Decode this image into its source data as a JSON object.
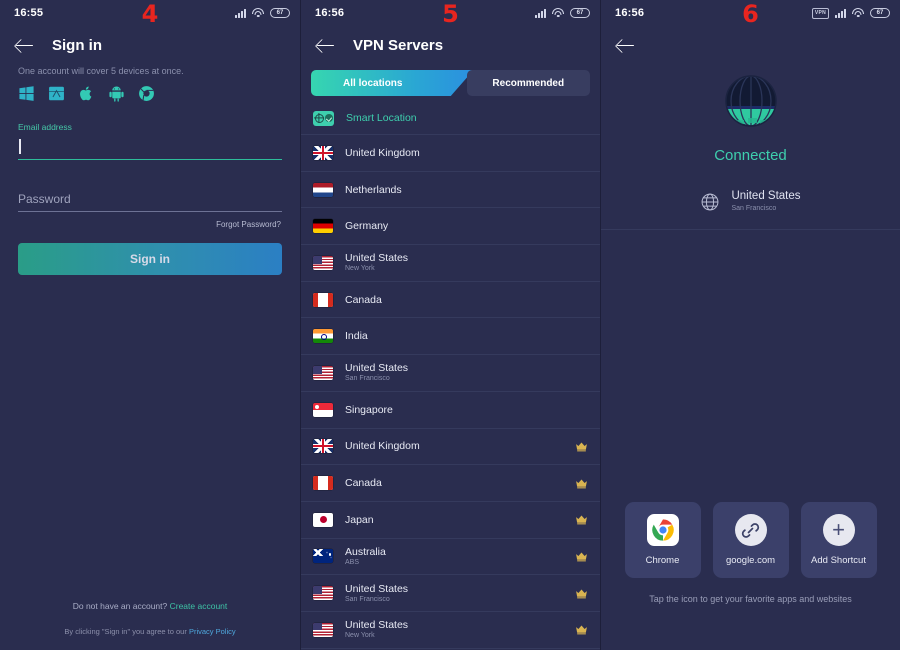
{
  "panels": [
    {
      "step": "4",
      "status": {
        "time": "16:55",
        "battery": "67",
        "vpn_badge": "",
        "has_vpn": false
      },
      "appbar": {
        "title": "Sign in",
        "back": "back-arrow"
      },
      "subtitle": "One account will cover 5 devices at once.",
      "platforms": [
        "windows-icon",
        "mac-icon",
        "apple-icon",
        "android-icon",
        "chrome-icon"
      ],
      "email": {
        "label": "Email address",
        "value": ""
      },
      "password": {
        "placeholder": "Password",
        "value": ""
      },
      "forgot_password": "Forgot Password?",
      "signin_button": "Sign in",
      "footer": {
        "no_account_text": "Do not have an account?",
        "create_account": "Create account",
        "terms_prefix": "By clicking \"Sign in\" you agree to our",
        "privacy_policy": "Privacy Policy"
      }
    },
    {
      "step": "5",
      "status": {
        "time": "16:56",
        "battery": "67",
        "has_vpn": false
      },
      "appbar": {
        "title": "VPN Servers"
      },
      "tabs": [
        {
          "label": "All locations",
          "active": true
        },
        {
          "label": "Recommended",
          "active": false
        }
      ],
      "smart_location": "Smart Location",
      "servers": [
        {
          "name": "United Kingdom",
          "city": "",
          "flag": "f-uk",
          "premium": false
        },
        {
          "name": "Netherlands",
          "city": "",
          "flag": "f-nl",
          "premium": false
        },
        {
          "name": "Germany",
          "city": "",
          "flag": "f-de",
          "premium": false
        },
        {
          "name": "United States",
          "city": "New York",
          "flag": "f-us",
          "premium": false
        },
        {
          "name": "Canada",
          "city": "",
          "flag": "f-ca",
          "premium": false
        },
        {
          "name": "India",
          "city": "",
          "flag": "f-in",
          "premium": false
        },
        {
          "name": "United States",
          "city": "San Francisco",
          "flag": "f-us",
          "premium": false
        },
        {
          "name": "Singapore",
          "city": "",
          "flag": "f-sg",
          "premium": false
        },
        {
          "name": "United Kingdom",
          "city": "",
          "flag": "f-uk",
          "premium": true
        },
        {
          "name": "Canada",
          "city": "",
          "flag": "f-ca",
          "premium": true
        },
        {
          "name": "Japan",
          "city": "",
          "flag": "f-jp",
          "premium": true
        },
        {
          "name": "Australia",
          "city": "ABS",
          "flag": "f-au",
          "premium": true
        },
        {
          "name": "United States",
          "city": "San Francisco",
          "flag": "f-us",
          "premium": true
        },
        {
          "name": "United States",
          "city": "New York",
          "flag": "f-us",
          "premium": true
        }
      ]
    },
    {
      "step": "6",
      "status": {
        "time": "16:56",
        "battery": "67",
        "vpn_badge": "VPN",
        "has_vpn": true
      },
      "appbar": {
        "title": ""
      },
      "connection": {
        "status_text": "Connected",
        "location_name": "United States",
        "location_city": "San Francisco"
      },
      "shortcuts": [
        {
          "label": "Chrome",
          "icon": "chrome-icon"
        },
        {
          "label": "google.com",
          "icon": "link-icon"
        },
        {
          "label": "Add Shortcut",
          "icon": "plus-icon"
        }
      ],
      "tip": "Tap the icon to get your favorite apps and websites"
    }
  ],
  "colors": {
    "background": "#2a2d4f",
    "accent_teal": "#3ecfae",
    "accent_blue": "#2b8fe0",
    "step_red": "#e8251f",
    "card": "#3b406a",
    "divider": "#353a5d"
  }
}
